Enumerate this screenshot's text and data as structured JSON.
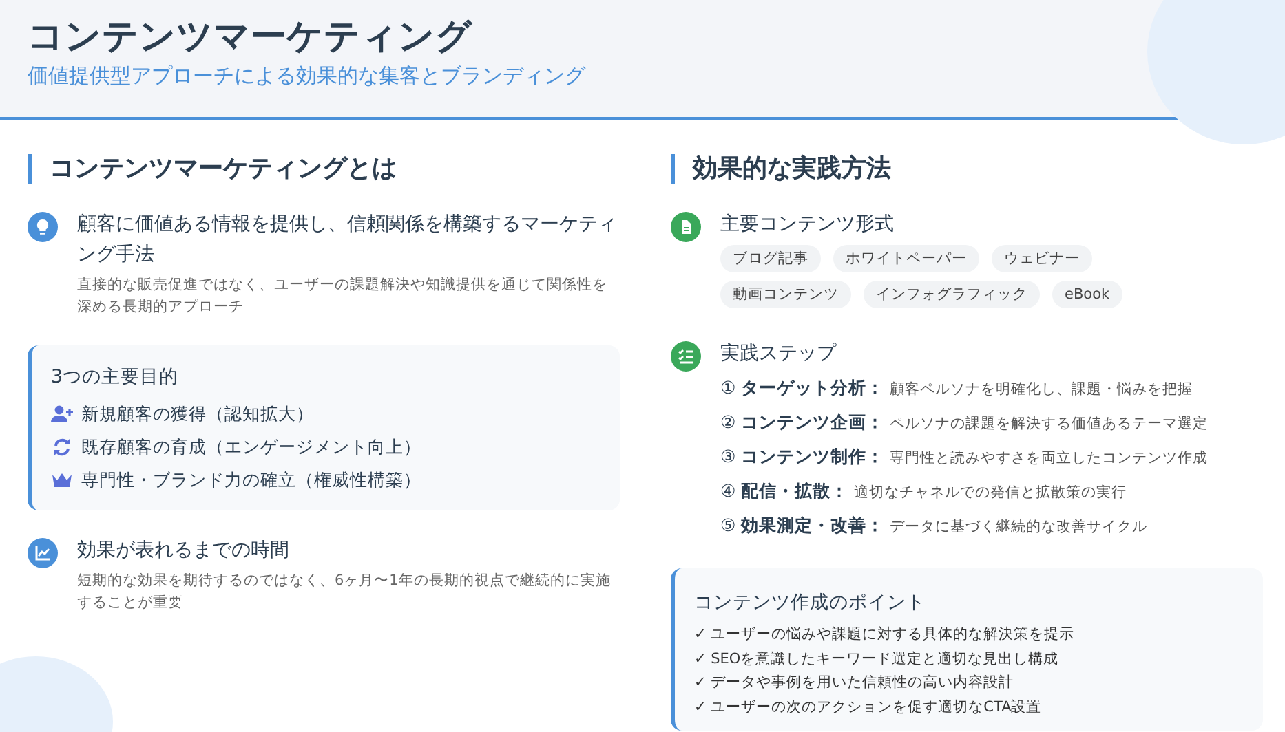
{
  "header": {
    "title": "コンテンツマーケティング",
    "subtitle": "価値提供型アプローチによる効果的な集客とブランディング"
  },
  "left": {
    "heading": "コンテンツマーケティングとは",
    "definition": {
      "title": "顧客に価値ある情報を提供し、信頼関係を構築するマーケティング手法",
      "description": "直接的な販売促進ではなく、ユーザーの課題解決や知識提供を通じて関係性を深める長期的アプローチ"
    },
    "goals": {
      "title": "3つの主要目的",
      "items": [
        "新規顧客の獲得（認知拡大）",
        "既存顧客の育成（エンゲージメント向上）",
        "専門性・ブランド力の確立（権威性構築）"
      ]
    },
    "timeline": {
      "title": "効果が表れるまでの時間",
      "description": "短期的な効果を期待するのではなく、6ヶ月〜1年の長期的視点で継続的に実施することが重要"
    }
  },
  "right": {
    "heading": "効果的な実践方法",
    "formats": {
      "title": "主要コンテンツ形式",
      "tags": [
        "ブログ記事",
        "ホワイトペーパー",
        "ウェビナー",
        "動画コンテンツ",
        "インフォグラフィック",
        "eBook"
      ]
    },
    "steps": {
      "title": "実践ステップ",
      "items": [
        {
          "number": "①",
          "label": "ターゲット分析：",
          "description": "顧客ペルソナを明確化し、課題・悩みを把握"
        },
        {
          "number": "②",
          "label": "コンテンツ企画：",
          "description": "ペルソナの課題を解決する価値あるテーマ選定"
        },
        {
          "number": "③",
          "label": "コンテンツ制作：",
          "description": "専門性と読みやすさを両立したコンテンツ作成"
        },
        {
          "number": "④",
          "label": "配信・拡散：",
          "description": "適切なチャネルでの発信と拡散策の実行"
        },
        {
          "number": "⑤",
          "label": "効果測定・改善：",
          "description": "データに基づく継続的な改善サイクル"
        }
      ]
    },
    "points": {
      "title": "コンテンツ作成のポイント",
      "items": [
        "✓ ユーザーの悩みや課題に対する具体的な解決策を提示",
        "✓ SEOを意識したキーワード選定と適切な見出し構成",
        "✓ データや事例を用いた信頼性の高い内容設計",
        "✓ ユーザーの次のアクションを促す適切なCTA設置"
      ]
    }
  }
}
